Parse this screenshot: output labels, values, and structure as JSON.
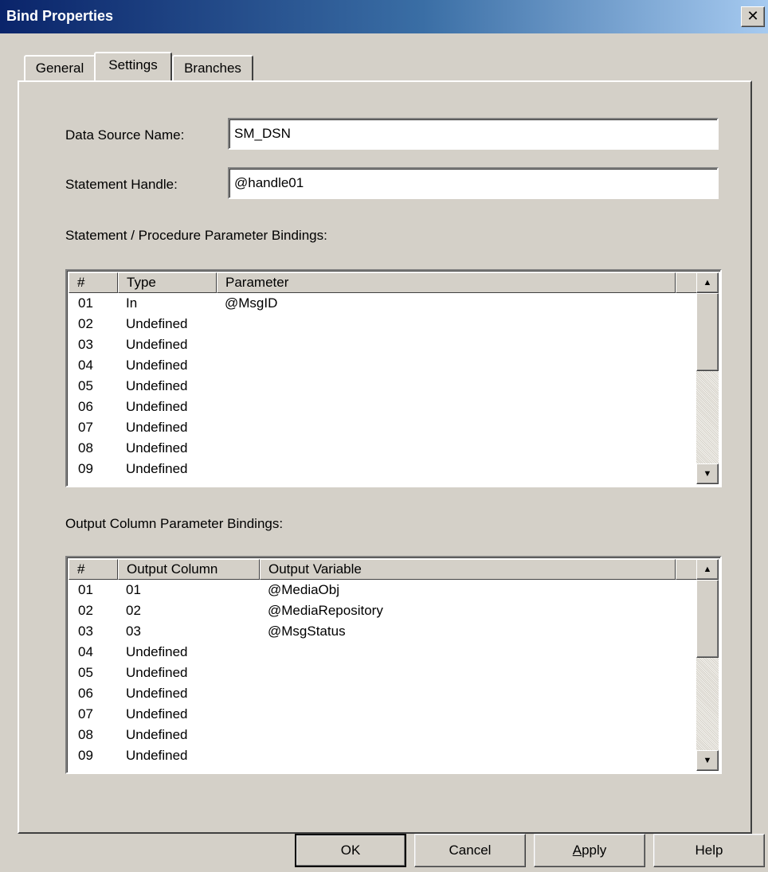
{
  "window": {
    "title": "Bind Properties",
    "close_glyph": "✕"
  },
  "tabs": [
    {
      "label": "General",
      "active": false
    },
    {
      "label": "Settings",
      "active": true
    },
    {
      "label": "Branches",
      "active": false
    }
  ],
  "settings": {
    "dsn_label": "Data Source Name:",
    "dsn_value": "SM_DSN",
    "handle_label": "Statement Handle:",
    "handle_value": "@handle01",
    "param_section_label": "Statement / Procedure Parameter Bindings:",
    "output_section_label": "Output Column Parameter Bindings:"
  },
  "param_table": {
    "columns": [
      "#",
      "Type",
      "Parameter"
    ],
    "rows": [
      [
        "01",
        "In",
        "@MsgID"
      ],
      [
        "02",
        "Undefined",
        ""
      ],
      [
        "03",
        "Undefined",
        ""
      ],
      [
        "04",
        "Undefined",
        ""
      ],
      [
        "05",
        "Undefined",
        ""
      ],
      [
        "06",
        "Undefined",
        ""
      ],
      [
        "07",
        "Undefined",
        ""
      ],
      [
        "08",
        "Undefined",
        ""
      ],
      [
        "09",
        "Undefined",
        ""
      ]
    ]
  },
  "output_table": {
    "columns": [
      "#",
      "Output Column",
      "Output Variable"
    ],
    "rows": [
      [
        "01",
        "01",
        "@MediaObj"
      ],
      [
        "02",
        "02",
        "@MediaRepository"
      ],
      [
        "03",
        "03",
        "@MsgStatus"
      ],
      [
        "04",
        "Undefined",
        ""
      ],
      [
        "05",
        "Undefined",
        ""
      ],
      [
        "06",
        "Undefined",
        ""
      ],
      [
        "07",
        "Undefined",
        ""
      ],
      [
        "08",
        "Undefined",
        ""
      ],
      [
        "09",
        "Undefined",
        ""
      ]
    ]
  },
  "buttons": {
    "ok": "OK",
    "cancel": "Cancel",
    "apply_mnemonic": "A",
    "apply_rest": "pply",
    "help": "Help"
  },
  "scroll_glyphs": {
    "up": "▲",
    "down": "▼"
  },
  "colors": {
    "titlebar_start": "#0a246a",
    "titlebar_end": "#a6caf0",
    "face": "#d4d0c8"
  }
}
